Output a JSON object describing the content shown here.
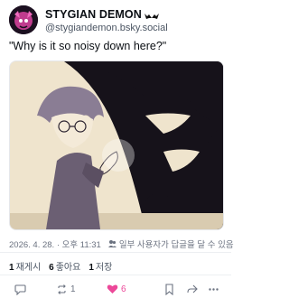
{
  "author": {
    "display_name": "STYGIAN DEMON",
    "handle": "@stygiandemon.bsky.social"
  },
  "post": {
    "text": "\"Why is it so noisy down here?\""
  },
  "meta": {
    "timestamp": "2026. 4. 28. · 오후 11:31",
    "audience_note": "일부 사용자가 답글을 달 수 있음"
  },
  "stats": {
    "reposts_count": "1",
    "reposts_label": "재게시",
    "likes_count": "6",
    "likes_label": "좋아요",
    "saves_count": "1",
    "saves_label": "저장"
  },
  "actions": {
    "reply_icon": "comment-icon",
    "repost_count": "1",
    "like_count": "6"
  },
  "colors": {
    "like_accent": "#ec4899",
    "muted_text": "#6b7280",
    "image_bg": "#f1e8d5"
  }
}
